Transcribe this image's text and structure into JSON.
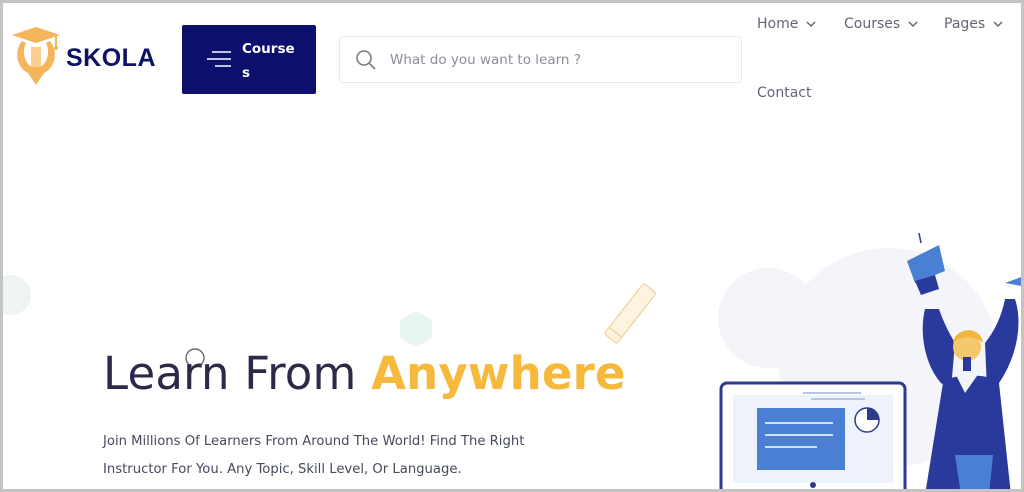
{
  "brand": {
    "name": "SKOLA",
    "primary_color": "#0c0f6b",
    "accent_color": "#f6b93b"
  },
  "header": {
    "courses_button": {
      "label": "Courses",
      "icon": "menu-lines-icon"
    },
    "search": {
      "placeholder": "What do you want to learn ?",
      "value": "",
      "icon": "search-icon"
    },
    "nav": [
      {
        "label": "Home",
        "has_dropdown": true
      },
      {
        "label": "Courses",
        "has_dropdown": true
      },
      {
        "label": "Pages",
        "has_dropdown": true
      },
      {
        "label": "Contact",
        "has_dropdown": false
      }
    ]
  },
  "hero": {
    "title_part1": "Learn From ",
    "title_accent": "Anywhere",
    "subtitle_line1": "Join Millions Of Learners From Around The World! Find The Right",
    "subtitle_line2": "Instructor For You. Any Topic, Skill Level, Or Language."
  }
}
